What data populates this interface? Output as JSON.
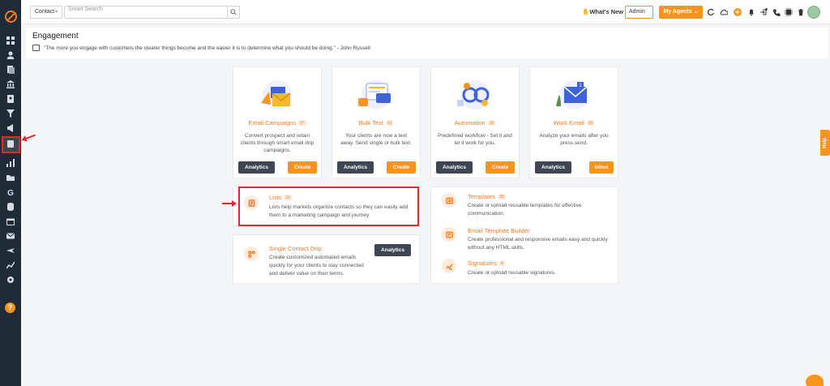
{
  "sidebar": {
    "icons": [
      "dashboard-icon",
      "contacts-icon",
      "documents-icon",
      "bank-icon",
      "badge-icon",
      "filter-icon",
      "megaphone-icon",
      "clipboard-icon",
      "bar-chart-icon",
      "folder-icon",
      "g-icon",
      "database-icon",
      "calendar-icon",
      "mail-icon",
      "plane-icon",
      "line-chart-icon",
      "settings-icon"
    ],
    "help_label": "?"
  },
  "topbar": {
    "contact_select": "Contact",
    "search_placeholder": "Smart Search",
    "whats_new": "What's New",
    "admin_select": "Admin",
    "agents_button": "My Agents"
  },
  "header": {
    "title": "Engagement",
    "quote": "\"The more you engage with customers the clearer things become and the easier it is to determine what you should be doing.\" - John Russell"
  },
  "cards": [
    {
      "title": "Email Campaigns",
      "count": "27",
      "desc": "Convert prospect and retain clients through smart email drip campaigns.",
      "btn1": "Analytics",
      "btn2": "Create"
    },
    {
      "title": "Bulk Text",
      "count": "12",
      "desc": "Your clients are now a text away. Send single or bulk text.",
      "btn1": "Analytics",
      "btn2": "Create"
    },
    {
      "title": "Automation",
      "count": "20",
      "desc": "Predefined workflow - Set it and let it work for you.",
      "btn1": "Analytics",
      "btn2": "Create"
    },
    {
      "title": "Work Email",
      "count": "25",
      "desc": "Analyze your emails after you press send.",
      "btn1": "Analytics",
      "btn2": "Inbox"
    }
  ],
  "lists": {
    "title": "Lists",
    "count": "15",
    "desc": "Lists help markets organize contacts so they can easily add them to a marketing campaign and journey"
  },
  "drip": {
    "title": "Single Contact Drip",
    "desc": "Create customized automated emails quickly for your clients to stay connected and deliver value on their terms.",
    "button": "Analytics"
  },
  "templates": {
    "title": "Templates",
    "count": "25",
    "desc": "Create or upload reusable templates for effective communication."
  },
  "builder": {
    "title": "Email Template Builder",
    "desc": "Create professional and responsive emails easy and quickly without any HTML skills."
  },
  "signatures": {
    "title": "Signatures",
    "count": "0",
    "desc": "Create or upload reusable signatures."
  },
  "help_tab": "Help",
  "colors": {
    "accent": "#f7941d",
    "sidebar": "#1f2b37",
    "highlight": "#e12b2b",
    "dark_button": "#3d4652"
  }
}
